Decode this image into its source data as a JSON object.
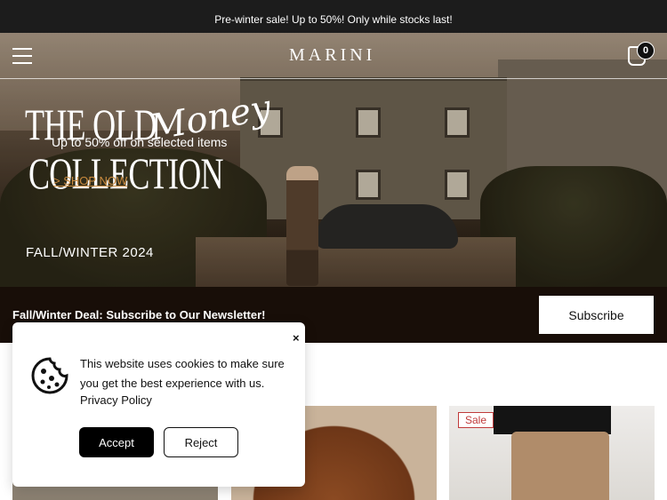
{
  "announcement": "Pre-winter sale!   Up to 50%! Only while stocks last!",
  "header": {
    "logo": "MARINI",
    "cart_count": "0"
  },
  "hero": {
    "title_line1": "THE OLD",
    "title_script": "Money",
    "title_line2": "COLLECTION",
    "promo": "Up to 50% off on selected items",
    "cta": "SHOP NOW",
    "season": "FALL/WINTER 2024"
  },
  "newsletter": {
    "text": "Fall/Winter Deal: Subscribe to Our Newsletter!",
    "button": "Subscribe"
  },
  "products": {
    "badge": "Sale"
  },
  "cookie": {
    "close": "×",
    "message": "This website uses cookies to make sure you get the best experience with us.",
    "policy_link": "Privacy Policy",
    "accept": "Accept",
    "reject": "Reject"
  }
}
